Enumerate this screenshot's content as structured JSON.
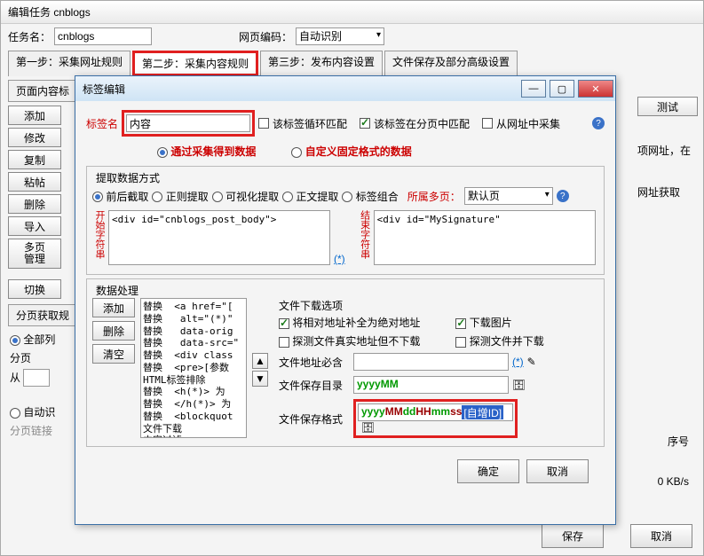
{
  "main": {
    "title": "编辑任务 cnblogs",
    "task_label": "任务名：",
    "task_value": "cnblogs",
    "encoding_label": "网页编码：",
    "encoding_value": "自动识别",
    "steps": {
      "s1": "第一步：采集网址规则",
      "s2": "第二步：采集内容规则",
      "s3": "第三步：发布内容设置",
      "s4": "文件保存及部分高级设置"
    },
    "panel_tab": "页面内容标",
    "side_buttons": [
      "添加",
      "修改",
      "复制",
      "粘帖",
      "删除",
      "导入"
    ],
    "multi_btn_l1": "多页",
    "multi_btn_l2": "管理",
    "switch_btn": "切换",
    "page_fetch_tab": "分页获取规",
    "opt_all": "全部列",
    "page_label": "分页",
    "from_label": "从",
    "opt_auto": "自动识",
    "page_link": "分页链接",
    "seq_label": "序号",
    "speed_label": "0 KB/s",
    "save_btn": "保存",
    "cancel_btn": "取消",
    "test_btn": "测试",
    "frag1": "项网址，在",
    "frag2": "网址获取"
  },
  "dialog": {
    "title": "标签编辑",
    "tag_label": "标签名",
    "tag_value": "内容",
    "loop_match": "该标签循环匹配",
    "page_match": "该标签在分页中匹配",
    "from_url": "从网址中采集",
    "mode_collect": "通过采集得到数据",
    "mode_custom": "自定义固定格式的数据",
    "extract_group": "提取数据方式",
    "ex_cut": "前后截取",
    "ex_regex": "正则提取",
    "ex_visual": "可视化提取",
    "ex_text": "正文提取",
    "ex_group": "标签组合",
    "belong_label": "所属多页：",
    "belong_value": "默认页",
    "start_label": "开始字符串",
    "start_value": "<div id=\"cnblogs_post_body\">",
    "end_label": "结束字符串",
    "end_value": "<div id=\"MySignature\"",
    "proc_group": "数据处理",
    "proc_btns": [
      "添加",
      "删除",
      "清空"
    ],
    "proc_list": "替换  <a href=\"[\n替换   alt=\"(*)\"\n替换   data-orig\n替换   data-src=\"\n替换  <div class\n替换  <pre>[参数\nHTML标签排除\n替换  <h(*)> 为\n替换  </h(*)> 为\n替换  <blockquot\n文件下载\n内容过滤",
    "dl_group": "文件下载选项",
    "dl_abs": "将相对地址补全为绝对地址",
    "dl_img": "下载图片",
    "dl_probe": "探测文件真实地址但不下载",
    "dl_probe_dl": "探测文件并下载",
    "url_contain": "文件地址必含",
    "save_dir": "文件保存目录",
    "save_dir_val": "yyyyMM",
    "save_fmt": "文件保存格式",
    "save_fmt_p1": "yyyyMMddHHmmss",
    "save_fmt_sel": "[自增ID]",
    "asterisk": "(*)",
    "ok": "确定",
    "cancel": "取消"
  }
}
